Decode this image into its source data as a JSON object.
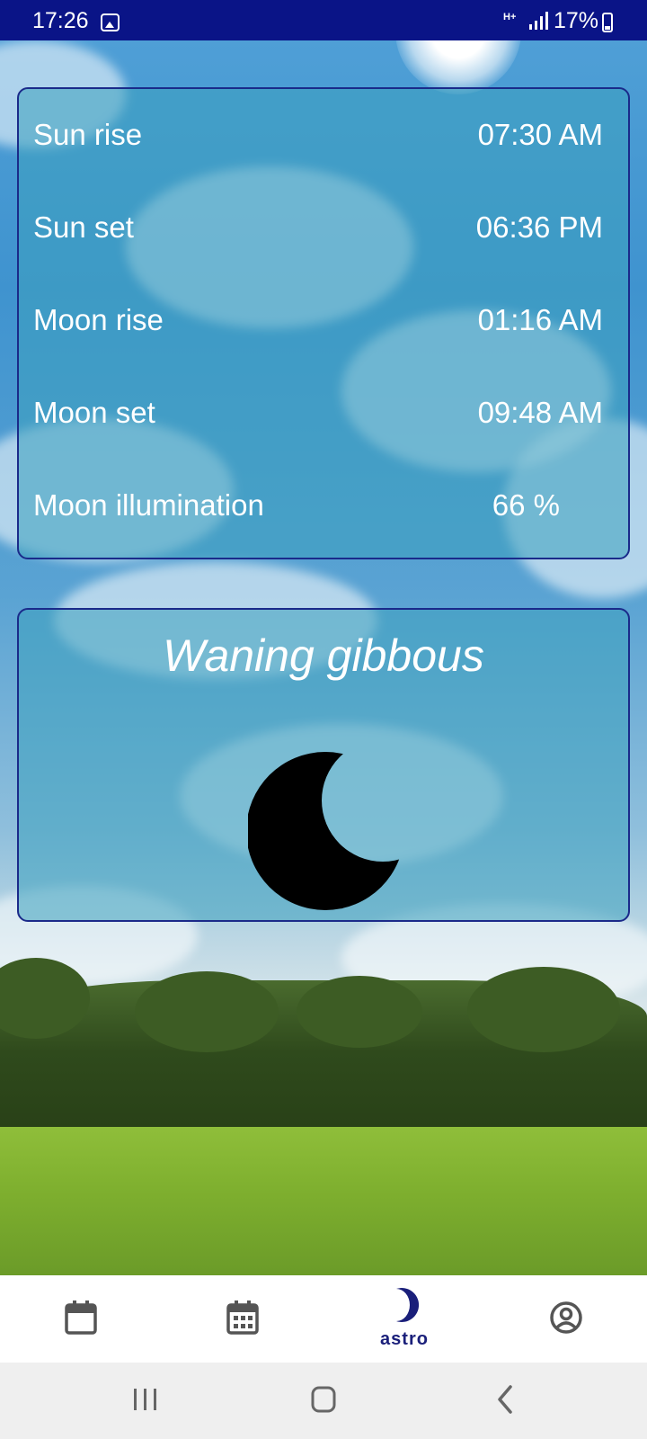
{
  "status_bar": {
    "time": "17:26",
    "network": "H+",
    "battery": "17%",
    "icons": [
      "photo-icon",
      "signal-icon",
      "battery-icon"
    ]
  },
  "astro": {
    "rows": [
      {
        "label": "Sun rise",
        "value": "07:30 AM"
      },
      {
        "label": "Sun set",
        "value": "06:36 PM"
      },
      {
        "label": "Moon rise",
        "value": "01:16 AM"
      },
      {
        "label": "Moon set",
        "value": "09:48 AM"
      },
      {
        "label": "Moon illumination",
        "value": "66 %"
      }
    ]
  },
  "moon_phase": {
    "title": "Waning gibbous",
    "icon": "moon-phase-icon"
  },
  "bottom_nav": {
    "items": [
      {
        "icon": "calendar-icon",
        "label": ""
      },
      {
        "icon": "calendar-grid-icon",
        "label": ""
      },
      {
        "icon": "crescent-moon-icon",
        "label": "astro",
        "active": true
      },
      {
        "icon": "account-icon",
        "label": ""
      }
    ],
    "active_color": "#1a1f7a"
  },
  "system_nav": {
    "icons": [
      "recents-icon",
      "home-icon",
      "back-icon"
    ]
  },
  "colors": {
    "status_bar": "#0a1487",
    "card_border": "#1a2a8a"
  }
}
